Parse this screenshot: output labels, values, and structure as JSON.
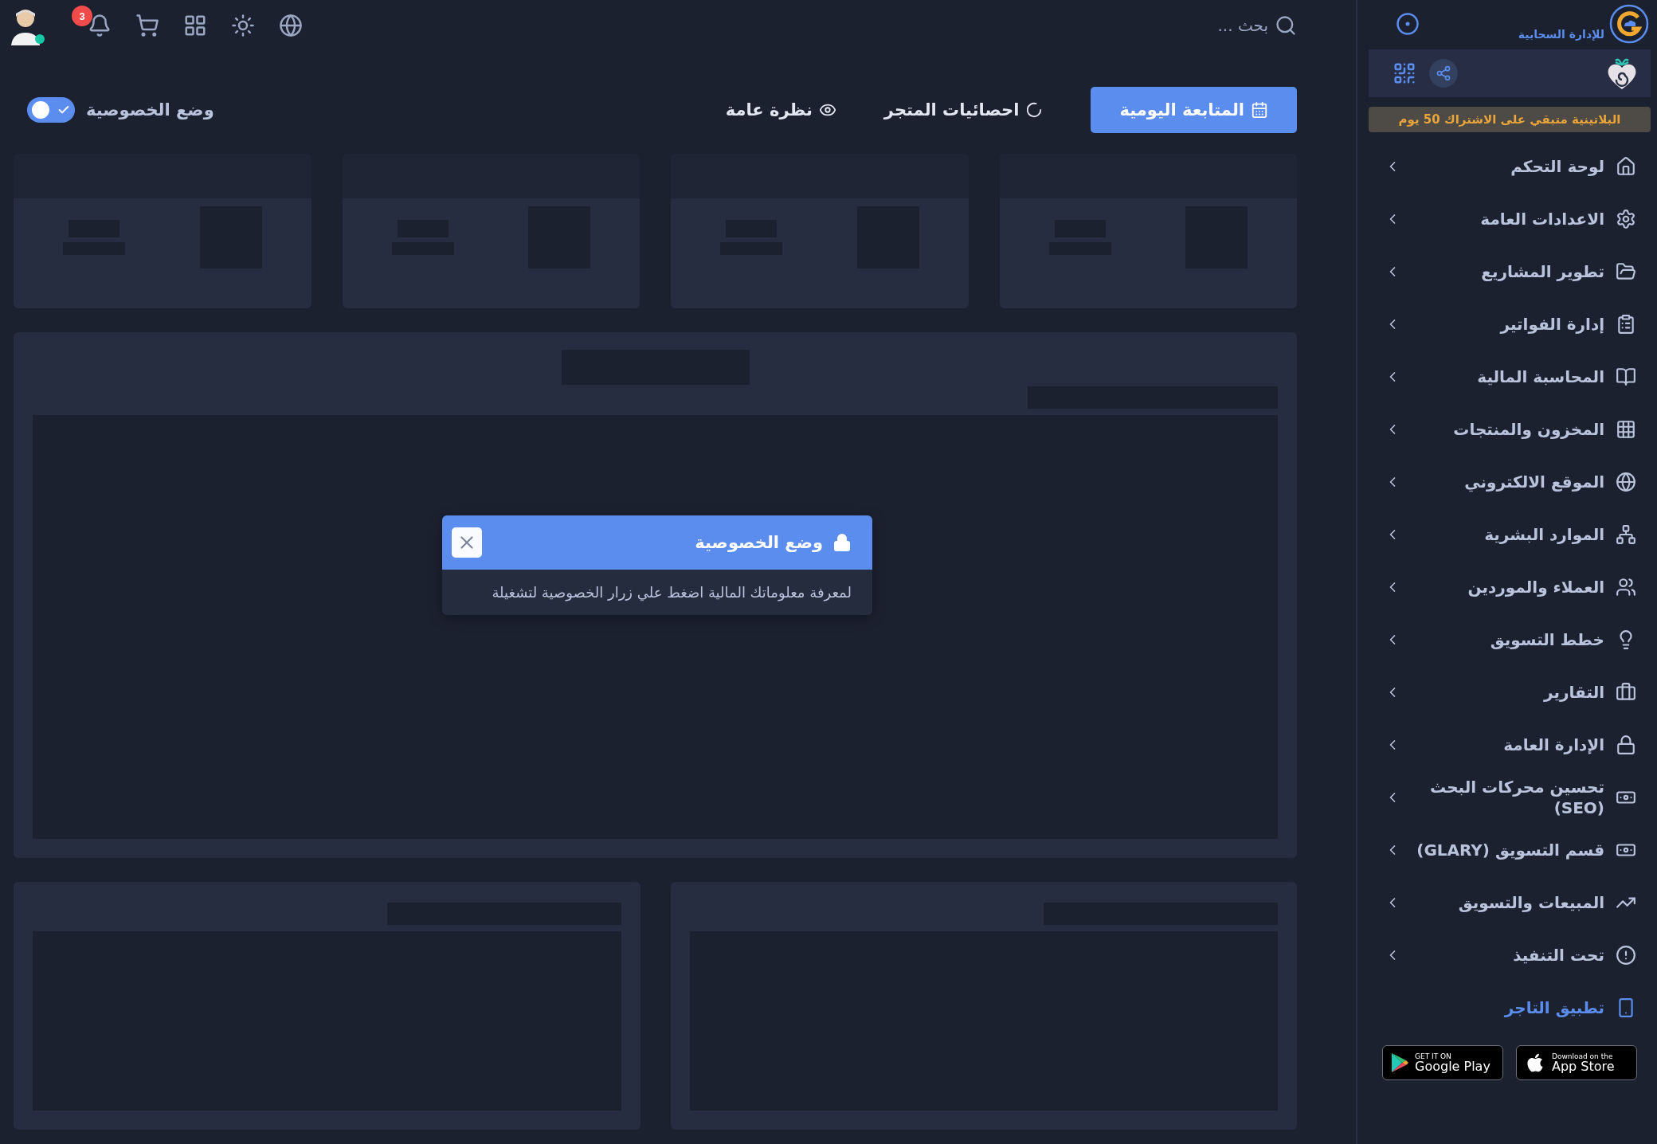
{
  "header": {
    "search_placeholder": "بحث ...",
    "notification_count": "3"
  },
  "logo": {
    "subtitle": "للإدارة السحابية"
  },
  "subscription_notice": "البلاتينية متبقي على الاشتراك 50 يوم",
  "sidebar": {
    "items": [
      {
        "label": "لوحة التحكم"
      },
      {
        "label": "الاعدادات العامة"
      },
      {
        "label": "تطوير المشاريع"
      },
      {
        "label": "إدارة الفواتير"
      },
      {
        "label": "المحاسبة المالية"
      },
      {
        "label": "المخزون والمنتجات"
      },
      {
        "label": "الموقع الالكتروني"
      },
      {
        "label": "الموارد البشرية"
      },
      {
        "label": "العملاء والموردين"
      },
      {
        "label": "خطط التسويق"
      },
      {
        "label": "التقارير"
      },
      {
        "label": "الإدارة العامة"
      },
      {
        "label": "تحسين محركات البحث (SEO)"
      },
      {
        "label": "قسم التسويق (GLARY)"
      },
      {
        "label": "المبيعات والتسويق"
      },
      {
        "label": "تحت التنفيذ"
      }
    ],
    "app_link": "تطبيق التاجر"
  },
  "store_badges": [
    {
      "kind": "apple",
      "small": "Download on the",
      "big": "App Store"
    },
    {
      "kind": "google",
      "small": "GET IT ON",
      "big": "Google Play"
    }
  ],
  "tabs": [
    {
      "label": "المتابعة اليومية",
      "selected": true
    },
    {
      "label": "احصائيات المتجر",
      "selected": false
    },
    {
      "label": "نظرة عامة",
      "selected": false
    }
  ],
  "privacy_toggle": {
    "label": "وضع الخصوصية",
    "on": true
  },
  "modal": {
    "title": "وضع الخصوصية",
    "message": "لمعرفة معلوماتك المالية اضغط علي زرار الخصوصية لتشغيلة"
  }
}
